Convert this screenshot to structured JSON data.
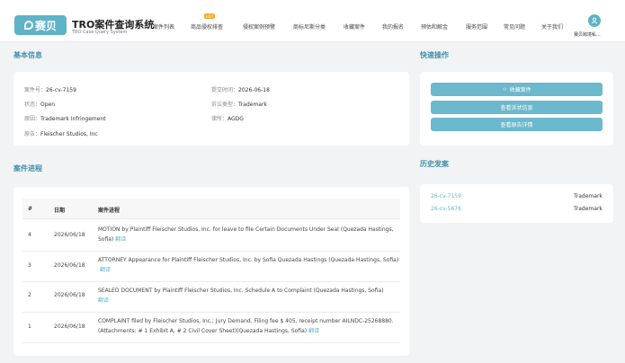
{
  "header": {
    "logo_text": "赛贝",
    "title": "TRO案件查询系统",
    "subtitle": "TRO Case Query System",
    "nav": [
      "案件列表",
      "商品侵权排查",
      "侵权案例预警",
      "商标尼斯分类",
      "收藏案件",
      "我的报名",
      "预估和解金",
      "服务范围",
      "常见问题",
      "关于我们"
    ],
    "hot_badge": "HOT",
    "username": "赛贝跨境私..."
  },
  "basic_info": {
    "title": "基本信息",
    "case_no_label": "案件号：",
    "case_no": "26-cv-7159",
    "filed_label": "提交时间：",
    "filed": "2026-06-18",
    "status_label": "状态：",
    "status": "Open",
    "type_label": "诉讼类型：",
    "type": "Trademark",
    "cause_label": "原因：",
    "cause": "Trademark Infringement",
    "firm_label": "律所：",
    "firm": "AGDG",
    "plaintiff_label": "原告：",
    "plaintiff": "Fleischer Studios, Inc"
  },
  "quick_actions": {
    "title": "快速操作",
    "favorite": "收藏案件",
    "view_complaint": "查看诉状信息",
    "view_details": "查看原告详情"
  },
  "history": {
    "title": "历史发案",
    "items": [
      {
        "case": "26-cv-7159",
        "type": "Trademark"
      },
      {
        "case": "26-cv-5676",
        "type": "Trademark"
      }
    ]
  },
  "progress": {
    "title": "案件进程",
    "headers": [
      "#",
      "日期",
      "案件进程"
    ],
    "detail_label": "翻译",
    "rows": [
      {
        "num": "4",
        "date": "2026/06/18",
        "text": "MOTION by Plaintiff Fleischer Studios, Inc. for leave to file Certain Documents Under Seal (Quezada Hastings, Sofia)"
      },
      {
        "num": "3",
        "date": "2026/06/18",
        "text": "ATTORNEY Appearance for Plaintiff Fleischer Studios, Inc. by Sofia Quezada Hastings (Quezada Hastings, Sofia)"
      },
      {
        "num": "2",
        "date": "2026/06/18",
        "text": "SEALED DOCUMENT by Plaintiff Fleischer Studios, Inc. Schedule A to Complaint (Quezada Hastings, Sofia)"
      },
      {
        "num": "1",
        "date": "2026/06/18",
        "text": "COMPLAINT filed by Fleischer Studios, Inc.; Jury Demand. Filing fee $ 405, receipt number AILNDC-25268880. (Attachments: # 1 Exhibit A, # 2 Civil Cover Sheet)(Quezada Hastings, Sofia)"
      }
    ]
  },
  "colors": {
    "accent": "#5fb3c7",
    "section_title": "#3f8fa8",
    "button": "#6cb8cc",
    "hot": "#f5a623"
  }
}
